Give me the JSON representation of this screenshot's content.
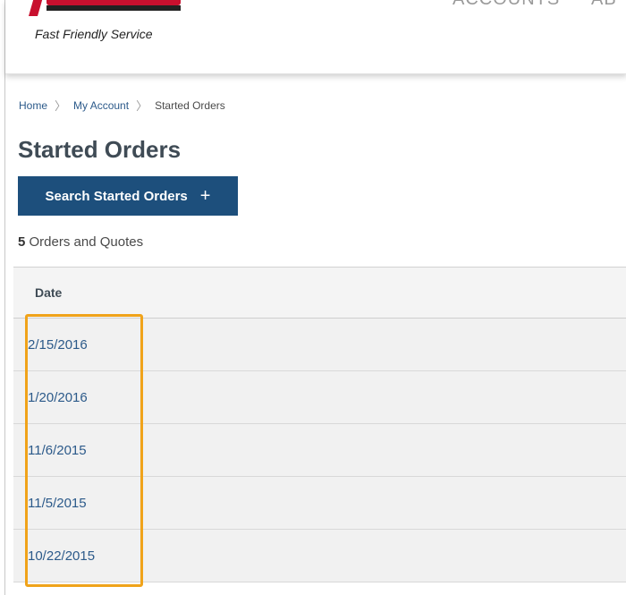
{
  "header": {
    "tagline": "Fast Friendly Service",
    "nav": [
      "ACCOUNTS",
      "AB"
    ]
  },
  "breadcrumb": {
    "home": "Home",
    "account": "My Account",
    "current": "Started Orders"
  },
  "page": {
    "title": "Started Orders",
    "search_button_label": "Search Started Orders",
    "count": "5",
    "count_label": "Orders and Quotes"
  },
  "table": {
    "header": "Date",
    "rows": [
      "2/15/2016",
      "1/20/2016",
      "11/6/2015",
      "11/5/2015",
      "10/22/2015"
    ]
  },
  "colors": {
    "brand_red": "#c8102e",
    "button_blue": "#1d4f7c",
    "link_blue": "#2c5a8a",
    "highlight": "#f0a31a"
  }
}
